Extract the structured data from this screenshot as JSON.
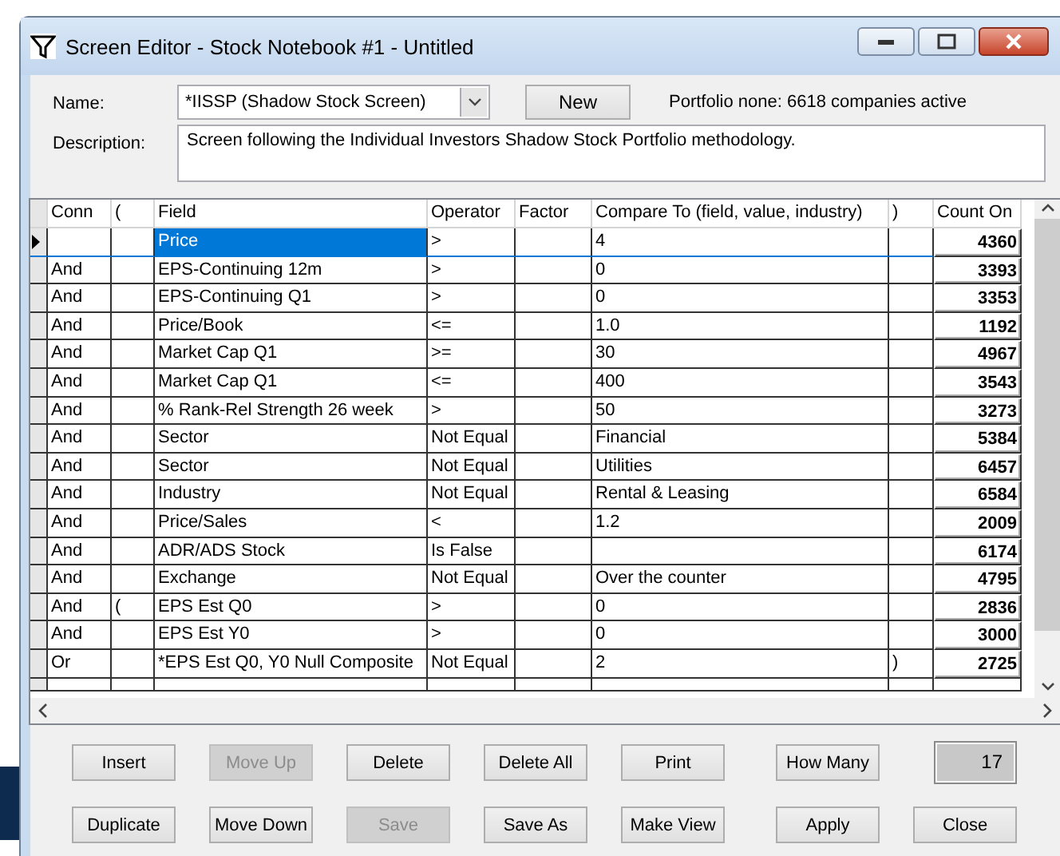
{
  "window": {
    "title": "Screen Editor - Stock Notebook #1 - Untitled"
  },
  "name_field": {
    "label": "Name:",
    "value": "*IISSP (Shadow Stock Screen)"
  },
  "new_button": "New",
  "portfolio_status": "Portfolio none: 6618 companies active",
  "description_field": {
    "label": "Description:",
    "value": "Screen following the Individual Investors Shadow Stock Portfolio methodology."
  },
  "table": {
    "columns": [
      "Conn",
      "(",
      "Field",
      "Operator",
      "Factor",
      "Compare To (field, value, industry)",
      ")",
      "Count On"
    ],
    "rows": [
      {
        "selected": true,
        "field": "Price",
        "operator": ">",
        "compare_to": "4",
        "count_on": "4360"
      },
      {
        "selected": false,
        "conn": "And",
        "field": "EPS-Continuing 12m",
        "operator": ">",
        "compare_to": "0",
        "count_on": "3393"
      },
      {
        "selected": false,
        "conn": "And",
        "field": "EPS-Continuing Q1",
        "operator": ">",
        "compare_to": "0",
        "count_on": "3353"
      },
      {
        "selected": false,
        "conn": "And",
        "field": "Price/Book",
        "operator": "<=",
        "compare_to": "1.0",
        "count_on": "1192"
      },
      {
        "selected": false,
        "conn": "And",
        "field": "Market Cap Q1",
        "operator": ">=",
        "compare_to": "30",
        "count_on": "4967"
      },
      {
        "selected": false,
        "conn": "And",
        "field": "Market Cap Q1",
        "operator": "<=",
        "compare_to": "400",
        "count_on": "3543"
      },
      {
        "selected": false,
        "conn": "And",
        "field": "% Rank-Rel Strength 26 week",
        "operator": ">",
        "compare_to": "50",
        "count_on": "3273"
      },
      {
        "selected": false,
        "conn": "And",
        "field": "Sector",
        "operator": "Not Equal",
        "compare_to": "Financial",
        "count_on": "5384"
      },
      {
        "selected": false,
        "conn": "And",
        "field": "Sector",
        "operator": "Not Equal",
        "compare_to": "Utilities",
        "count_on": "6457"
      },
      {
        "selected": false,
        "conn": "And",
        "field": "Industry",
        "operator": "Not Equal",
        "compare_to": "Rental & Leasing",
        "count_on": "6584"
      },
      {
        "selected": false,
        "conn": "And",
        "field": "Price/Sales",
        "operator": "<",
        "compare_to": "1.2",
        "count_on": "2009"
      },
      {
        "selected": false,
        "conn": "And",
        "field": "ADR/ADS Stock",
        "operator": "Is False",
        "count_on": "6174"
      },
      {
        "selected": false,
        "conn": "And",
        "field": "Exchange",
        "operator": "Not Equal",
        "compare_to": "Over the counter",
        "count_on": "4795"
      },
      {
        "selected": false,
        "conn": "And",
        "open_paren": "(",
        "field": "EPS Est Q0",
        "operator": ">",
        "compare_to": "0",
        "count_on": "2836"
      },
      {
        "selected": false,
        "conn": "And",
        "field": "EPS Est Y0",
        "operator": ">",
        "compare_to": "0",
        "count_on": "3000"
      },
      {
        "selected": false,
        "conn": "Or",
        "field": "*EPS Est Q0, Y0 Null Composite",
        "operator": "Not Equal",
        "compare_to": "2",
        "close_paren": ")",
        "count_on": "2725"
      }
    ]
  },
  "buttons": [
    {
      "label": "Insert",
      "disabled": false
    },
    {
      "label": "Move Up",
      "disabled": true
    },
    {
      "label": "Delete",
      "disabled": false
    },
    {
      "label": "Delete All",
      "disabled": false
    },
    {
      "label": "Print",
      "disabled": false
    },
    {
      "label": "How Many",
      "disabled": false
    },
    {
      "label": "Duplicate",
      "disabled": false
    },
    {
      "label": "Move Down",
      "disabled": false
    },
    {
      "label": "Save",
      "disabled": true
    },
    {
      "label": "Save As",
      "disabled": false
    },
    {
      "label": "Make View",
      "disabled": false
    },
    {
      "label": "Apply",
      "disabled": false
    },
    {
      "label": "Close",
      "disabled": false
    }
  ],
  "count_display": "17"
}
